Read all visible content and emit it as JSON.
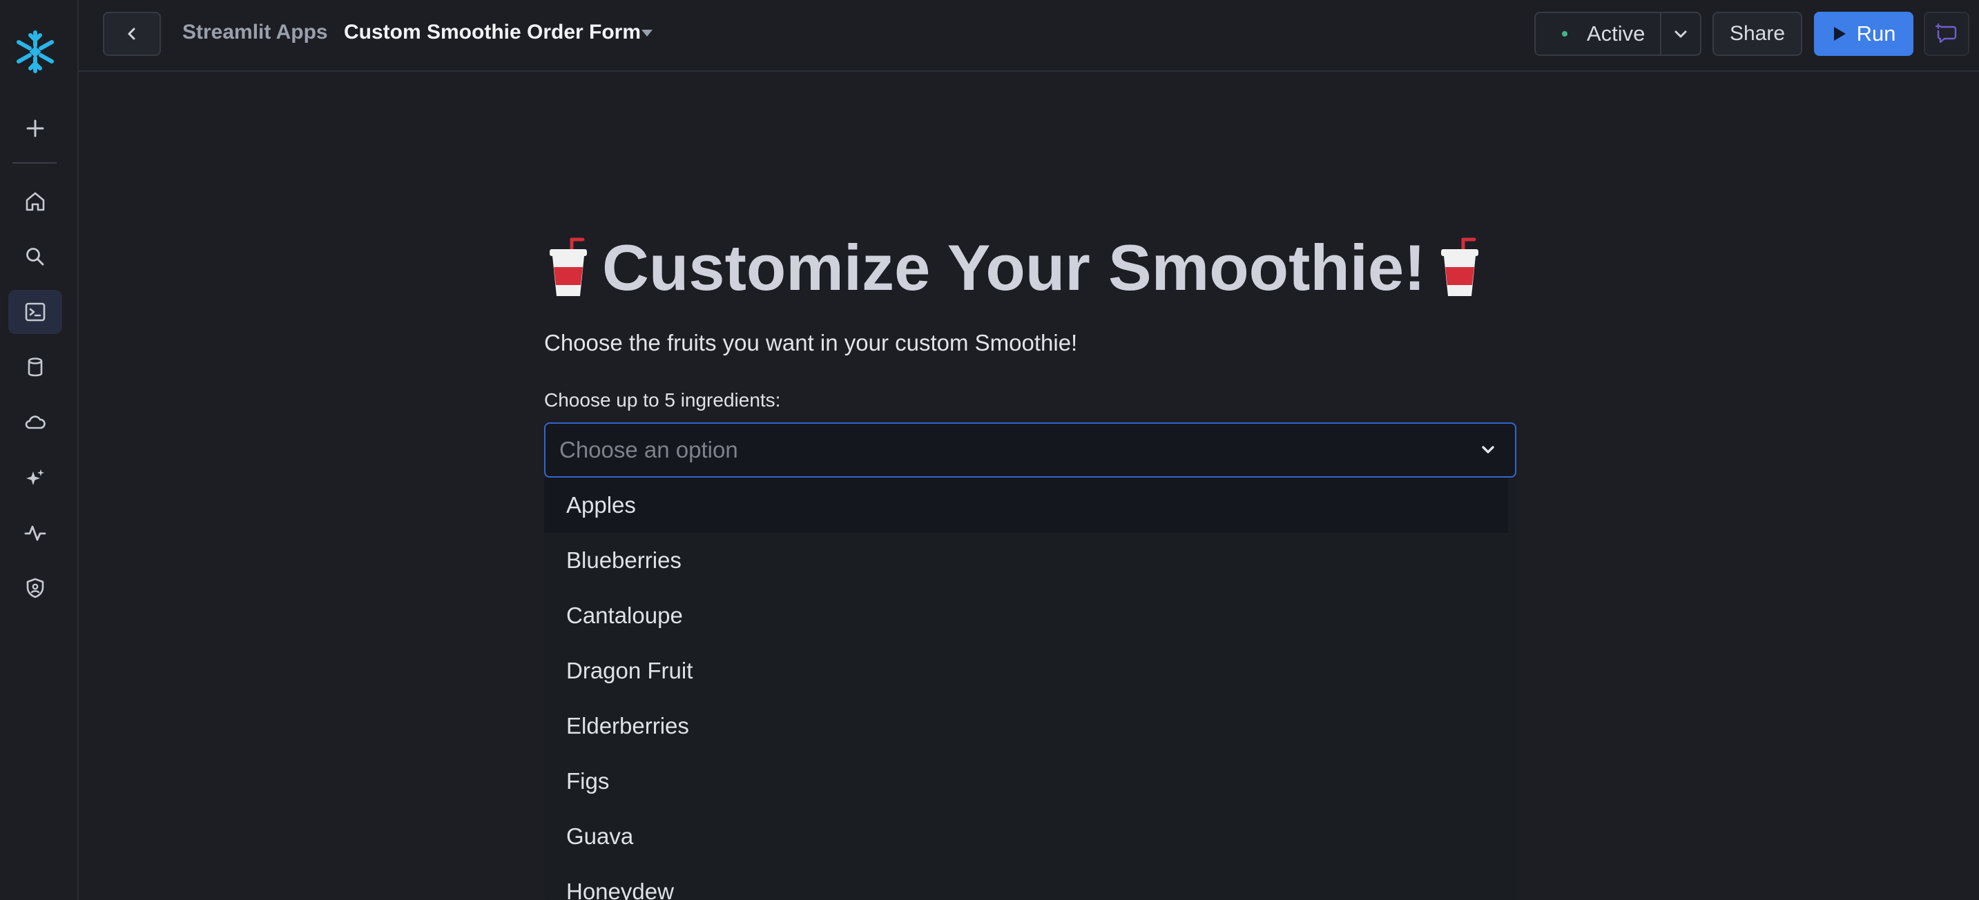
{
  "header": {
    "breadcrumb_parent": "Streamlit Apps",
    "app_title": "Custom Smoothie Order Form",
    "status_label": "Active",
    "share_label": "Share",
    "run_label": "Run"
  },
  "sidebar": {
    "items": [
      {
        "icon": "plus-icon"
      },
      {
        "icon": "home-icon"
      },
      {
        "icon": "search-icon"
      },
      {
        "icon": "terminal-icon",
        "active": true
      },
      {
        "icon": "database-icon"
      },
      {
        "icon": "cloud-icon"
      },
      {
        "icon": "sparkle-icon"
      },
      {
        "icon": "activity-icon"
      },
      {
        "icon": "shield-icon"
      }
    ]
  },
  "main": {
    "title": "Customize Your Smoothie!",
    "subtitle": "Choose the fruits you want in your custom Smoothie!",
    "select_label": "Choose up to 5 ingredients:",
    "select_placeholder": "Choose an option",
    "options": [
      "Apples",
      "Blueberries",
      "Cantaloupe",
      "Dragon Fruit",
      "Elderberries",
      "Figs",
      "Guava",
      "Honeydew"
    ]
  },
  "colors": {
    "accent": "#3d7ee8",
    "background": "#1c1e24",
    "status_green": "#3fb68b",
    "logo": "#29b5e8"
  }
}
